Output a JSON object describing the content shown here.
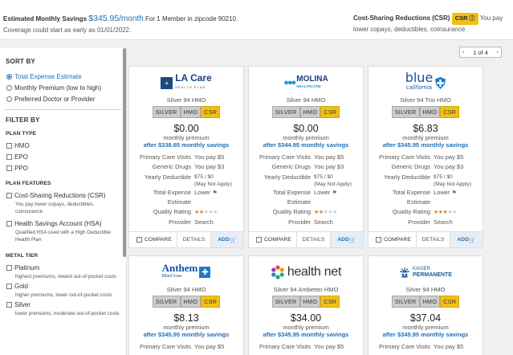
{
  "banner": {
    "label": "Estimated Monthly Savings",
    "amount": "$345.95",
    "unit": "/month",
    "for_text": "For 1 Member in zipcode 90210.",
    "coverage": "Coverage could start as early as 01/01/2022.",
    "csr_title": "Cost-Sharing Reductions (CSR)",
    "csr_badge": "CSR",
    "csr_after": "You pay",
    "csr_desc": "lower copays, deductibles, coinsurance"
  },
  "sidebar": {
    "sort_title": "SORT BY",
    "sort_options": [
      {
        "label": "Total Expense Estimate",
        "selected": true
      },
      {
        "label": "Monthly Premium (low to high)",
        "selected": false
      },
      {
        "label": "Preferred Doctor or Provider",
        "selected": false
      }
    ],
    "filter_title": "FILTER BY",
    "plan_type_title": "PLAN TYPE",
    "plan_types": [
      "HMO",
      "EPO",
      "PPO"
    ],
    "plan_features_title": "PLAN FEATURES",
    "features": [
      {
        "label": "Cost-Sharing Reductions (CSR)",
        "desc": "You pay lower copays, deductibles, coinsurance"
      },
      {
        "label": "Health Savings Account (HSA)",
        "desc": "Qualified HSA used with a High Deductible Health Plan"
      }
    ],
    "metal_title": "METAL TIER",
    "metals": [
      {
        "label": "Platinum",
        "desc": "highest premiums, lowest out-of-pocket costs"
      },
      {
        "label": "Gold",
        "desc": "higher premiums, lower out-of-pocket costs"
      },
      {
        "label": "Silver",
        "desc": "lower premiums, moderate out-of-pocket costs"
      }
    ]
  },
  "pager": {
    "text": "1 of 4",
    "prev": "‹",
    "next": "›"
  },
  "labels": {
    "monthly_premium": "monthly premium",
    "pcv": "Primary Care Visits",
    "generic": "Generic Drugs",
    "deductible": "Yearly Deductible",
    "tee": "Total Expense Estimate",
    "rating": "Quality Rating",
    "provider": "Provider",
    "search": "Search",
    "compare": "COMPARE",
    "details": "DETAILS",
    "add": "ADD",
    "silver": "SILVER",
    "hmo": "HMO",
    "csr": "CSR",
    "lower": "Lower"
  },
  "cards": [
    {
      "brand": "LA Care",
      "brand_sub": "HEALTH PLAN",
      "plan": "Silver 94 HMO",
      "price": "$0.00",
      "savings": "after $338.65 monthly savings",
      "pcv": "You pay $5",
      "generic": "You pay $3",
      "deductible": "$75 / $0",
      "deductible_note": "(May Not Apply)",
      "stars": 2
    },
    {
      "brand": "MOLINA",
      "brand_sub": "HEALTHCARE",
      "plan": "Silver 94 HMO",
      "price": "$0.00",
      "savings": "after $344.95 monthly savings",
      "pcv": "You pay $5",
      "generic": "You pay $3",
      "deductible": "$75 / $0",
      "deductible_note": "(May Not Apply)",
      "stars": 2
    },
    {
      "brand": "blue",
      "brand_sub": "california",
      "plan": "Silver 94 Trio HMO",
      "price": "$6.83",
      "savings": "after $345.95 monthly savings",
      "pcv": "You pay $5",
      "generic": "You pay $3",
      "deductible": "$75 / $0",
      "deductible_note": "(May Not Apply)",
      "stars": 3
    },
    {
      "brand": "Anthem",
      "brand_sub": "BlueCross",
      "plan": "Silver 94 HMO",
      "price": "$8.13",
      "savings": "after $345.95 monthly savings",
      "pcv": "You pay $5"
    },
    {
      "brand": "health net",
      "plan": "Silver 94 Ambetter HMO",
      "price": "$34.00",
      "savings": "after $345.95 monthly savings",
      "pcv": "You pay $5"
    },
    {
      "brand": "KAISER",
      "brand_sub": "PERMANENTE",
      "plan": "Silver 94 HMO",
      "price": "$37.04",
      "savings": "after $345.95 monthly savings",
      "pcv": "You pay $5"
    }
  ]
}
